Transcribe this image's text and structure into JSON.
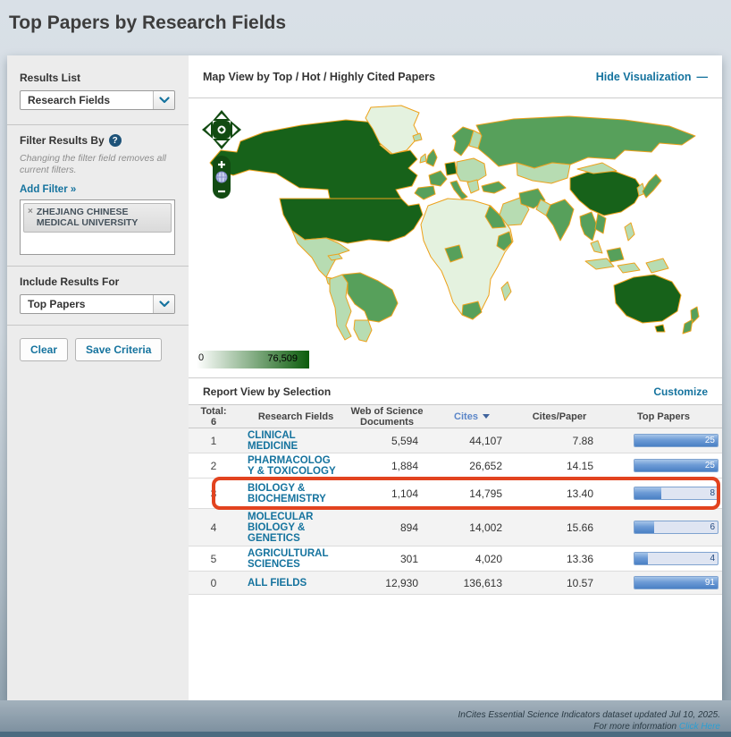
{
  "page": {
    "title": "Top Papers by Research Fields"
  },
  "sidebar": {
    "results_list_label": "Results List",
    "results_list_value": "Research Fields",
    "filter_label": "Filter Results By",
    "help_icon": "?",
    "filter_note": "Changing the filter field removes all current filters.",
    "add_filter_label": "Add Filter »",
    "filter_tag_remove": "×",
    "filter_tag": "ZHEJIANG CHINESE MEDICAL UNIVERSITY",
    "include_label": "Include Results For",
    "include_value": "Top Papers",
    "clear_button": "Clear",
    "save_button": "Save Criteria"
  },
  "map_section": {
    "title": "Map View by Top / Hot / Highly Cited Papers",
    "hide_link": "Hide Visualization",
    "hide_icon": "—",
    "legend_min": "0",
    "legend_max": "76,509",
    "palette": {
      "dark": "#17621a",
      "med": "#57a05b",
      "pale": "#b7dcb2",
      "vpale": "#e4f2df",
      "darkest": "#0b5c0b",
      "border": "#eda21c"
    }
  },
  "report": {
    "title": "Report View by Selection",
    "customize_link": "Customize",
    "headers": {
      "total_label": "Total:",
      "total_count": "6",
      "fields": "Research Fields",
      "wos": "Web of Science\nDocuments",
      "cites": "Cites",
      "cites_paper": "Cites/Paper",
      "top_papers": "Top Papers"
    },
    "rows": [
      {
        "rank": "1",
        "field": "CLINICAL\nMEDICINE",
        "wos": "5,594",
        "cites": "44,107",
        "cites_paper": "7.88",
        "top_papers": "25",
        "bar_pct": 100
      },
      {
        "rank": "2",
        "field": "PHARMACOLOG\nY & TOXICOLOGY",
        "wos": "1,884",
        "cites": "26,652",
        "cites_paper": "14.15",
        "top_papers": "25",
        "bar_pct": 100
      },
      {
        "rank": "3",
        "field": "BIOLOGY &\nBIOCHEMISTRY",
        "wos": "1,104",
        "cites": "14,795",
        "cites_paper": "13.40",
        "top_papers": "8",
        "bar_pct": 32
      },
      {
        "rank": "4",
        "field": "MOLECULAR\nBIOLOGY &\nGENETICS",
        "wos": "894",
        "cites": "14,002",
        "cites_paper": "15.66",
        "top_papers": "6",
        "bar_pct": 24
      },
      {
        "rank": "5",
        "field": "AGRICULTURAL\nSCIENCES",
        "wos": "301",
        "cites": "4,020",
        "cites_paper": "13.36",
        "top_papers": "4",
        "bar_pct": 16
      },
      {
        "rank": "0",
        "field": "ALL FIELDS",
        "wos": "12,930",
        "cites": "136,613",
        "cites_paper": "10.57",
        "top_papers": "91",
        "bar_pct": 100
      }
    ]
  },
  "footer": {
    "line1": "InCites Essential Science Indicators dataset updated Jul 10, 2025.",
    "line2": "For more information",
    "link": "Click Here"
  },
  "theme": {
    "accent": "#15739e",
    "highlight": "#e2431f",
    "bartrack": "#dfe5f2",
    "barborder": "#7fa3d0"
  }
}
